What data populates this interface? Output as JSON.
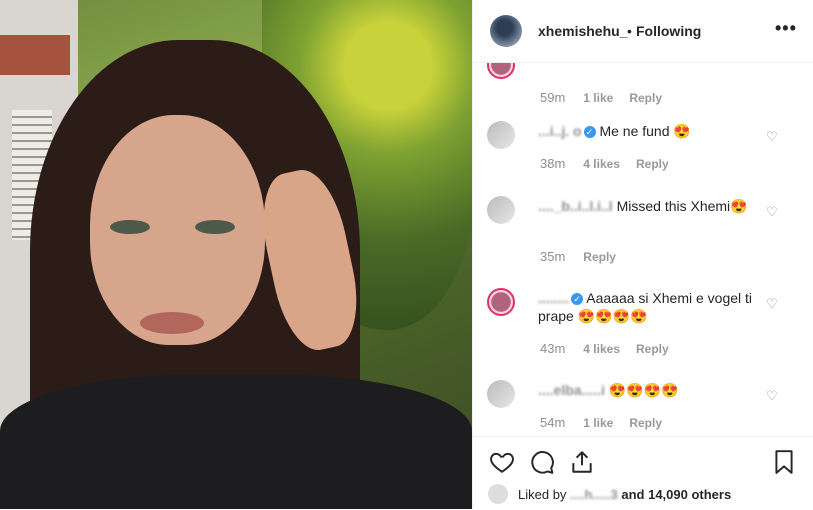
{
  "header": {
    "username": "xhemishehu_",
    "separator": "•",
    "follow_status": "Following",
    "more_label": "•••"
  },
  "comments": [
    {
      "user": "",
      "text": "",
      "time": "59m",
      "likes": "1 like",
      "reply": "Reply"
    },
    {
      "user": "...i..j. o",
      "verified": true,
      "text": "Me ne fund 😍",
      "time": "38m",
      "likes": "4 likes",
      "reply": "Reply"
    },
    {
      "user": "...._b..i..l.i..l",
      "verified": false,
      "text": "Missed this Xhemi😍",
      "time": "35m",
      "likes": "",
      "reply": "Reply"
    },
    {
      "user": "........",
      "verified": true,
      "text": "Aaaaaa si Xhemi e vogel ti prape 😍😍😍😍",
      "time": "43m",
      "likes": "4 likes",
      "reply": "Reply"
    },
    {
      "user": "....elba.....i",
      "verified": false,
      "text": "😍😍😍😍",
      "time": "54m",
      "likes": "1 like",
      "reply": "Reply"
    }
  ],
  "footer": {
    "liked_by_prefix": "Liked by",
    "liked_by_user": "....h.....3",
    "liked_by_suffix": "and 14,090 others"
  },
  "icons": {
    "like": "heart-icon",
    "comment": "comment-icon",
    "share": "share-icon",
    "save": "bookmark-icon",
    "more": "more-options-icon"
  }
}
